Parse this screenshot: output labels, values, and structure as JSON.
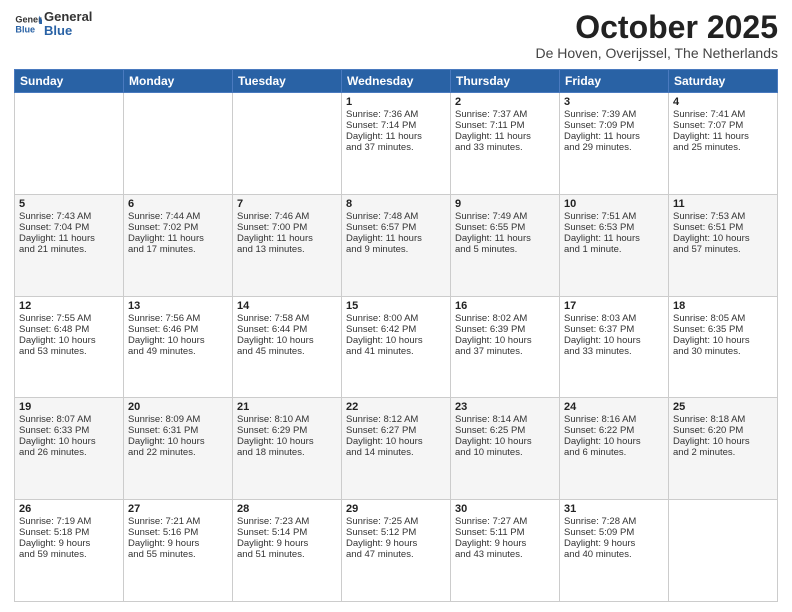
{
  "logo": {
    "general": "General",
    "blue": "Blue"
  },
  "title": "October 2025",
  "location": "De Hoven, Overijssel, The Netherlands",
  "days_of_week": [
    "Sunday",
    "Monday",
    "Tuesday",
    "Wednesday",
    "Thursday",
    "Friday",
    "Saturday"
  ],
  "weeks": [
    [
      {
        "day": "",
        "lines": []
      },
      {
        "day": "",
        "lines": []
      },
      {
        "day": "",
        "lines": []
      },
      {
        "day": "1",
        "lines": [
          "Sunrise: 7:36 AM",
          "Sunset: 7:14 PM",
          "Daylight: 11 hours",
          "and 37 minutes."
        ]
      },
      {
        "day": "2",
        "lines": [
          "Sunrise: 7:37 AM",
          "Sunset: 7:11 PM",
          "Daylight: 11 hours",
          "and 33 minutes."
        ]
      },
      {
        "day": "3",
        "lines": [
          "Sunrise: 7:39 AM",
          "Sunset: 7:09 PM",
          "Daylight: 11 hours",
          "and 29 minutes."
        ]
      },
      {
        "day": "4",
        "lines": [
          "Sunrise: 7:41 AM",
          "Sunset: 7:07 PM",
          "Daylight: 11 hours",
          "and 25 minutes."
        ]
      }
    ],
    [
      {
        "day": "5",
        "lines": [
          "Sunrise: 7:43 AM",
          "Sunset: 7:04 PM",
          "Daylight: 11 hours",
          "and 21 minutes."
        ]
      },
      {
        "day": "6",
        "lines": [
          "Sunrise: 7:44 AM",
          "Sunset: 7:02 PM",
          "Daylight: 11 hours",
          "and 17 minutes."
        ]
      },
      {
        "day": "7",
        "lines": [
          "Sunrise: 7:46 AM",
          "Sunset: 7:00 PM",
          "Daylight: 11 hours",
          "and 13 minutes."
        ]
      },
      {
        "day": "8",
        "lines": [
          "Sunrise: 7:48 AM",
          "Sunset: 6:57 PM",
          "Daylight: 11 hours",
          "and 9 minutes."
        ]
      },
      {
        "day": "9",
        "lines": [
          "Sunrise: 7:49 AM",
          "Sunset: 6:55 PM",
          "Daylight: 11 hours",
          "and 5 minutes."
        ]
      },
      {
        "day": "10",
        "lines": [
          "Sunrise: 7:51 AM",
          "Sunset: 6:53 PM",
          "Daylight: 11 hours",
          "and 1 minute."
        ]
      },
      {
        "day": "11",
        "lines": [
          "Sunrise: 7:53 AM",
          "Sunset: 6:51 PM",
          "Daylight: 10 hours",
          "and 57 minutes."
        ]
      }
    ],
    [
      {
        "day": "12",
        "lines": [
          "Sunrise: 7:55 AM",
          "Sunset: 6:48 PM",
          "Daylight: 10 hours",
          "and 53 minutes."
        ]
      },
      {
        "day": "13",
        "lines": [
          "Sunrise: 7:56 AM",
          "Sunset: 6:46 PM",
          "Daylight: 10 hours",
          "and 49 minutes."
        ]
      },
      {
        "day": "14",
        "lines": [
          "Sunrise: 7:58 AM",
          "Sunset: 6:44 PM",
          "Daylight: 10 hours",
          "and 45 minutes."
        ]
      },
      {
        "day": "15",
        "lines": [
          "Sunrise: 8:00 AM",
          "Sunset: 6:42 PM",
          "Daylight: 10 hours",
          "and 41 minutes."
        ]
      },
      {
        "day": "16",
        "lines": [
          "Sunrise: 8:02 AM",
          "Sunset: 6:39 PM",
          "Daylight: 10 hours",
          "and 37 minutes."
        ]
      },
      {
        "day": "17",
        "lines": [
          "Sunrise: 8:03 AM",
          "Sunset: 6:37 PM",
          "Daylight: 10 hours",
          "and 33 minutes."
        ]
      },
      {
        "day": "18",
        "lines": [
          "Sunrise: 8:05 AM",
          "Sunset: 6:35 PM",
          "Daylight: 10 hours",
          "and 30 minutes."
        ]
      }
    ],
    [
      {
        "day": "19",
        "lines": [
          "Sunrise: 8:07 AM",
          "Sunset: 6:33 PM",
          "Daylight: 10 hours",
          "and 26 minutes."
        ]
      },
      {
        "day": "20",
        "lines": [
          "Sunrise: 8:09 AM",
          "Sunset: 6:31 PM",
          "Daylight: 10 hours",
          "and 22 minutes."
        ]
      },
      {
        "day": "21",
        "lines": [
          "Sunrise: 8:10 AM",
          "Sunset: 6:29 PM",
          "Daylight: 10 hours",
          "and 18 minutes."
        ]
      },
      {
        "day": "22",
        "lines": [
          "Sunrise: 8:12 AM",
          "Sunset: 6:27 PM",
          "Daylight: 10 hours",
          "and 14 minutes."
        ]
      },
      {
        "day": "23",
        "lines": [
          "Sunrise: 8:14 AM",
          "Sunset: 6:25 PM",
          "Daylight: 10 hours",
          "and 10 minutes."
        ]
      },
      {
        "day": "24",
        "lines": [
          "Sunrise: 8:16 AM",
          "Sunset: 6:22 PM",
          "Daylight: 10 hours",
          "and 6 minutes."
        ]
      },
      {
        "day": "25",
        "lines": [
          "Sunrise: 8:18 AM",
          "Sunset: 6:20 PM",
          "Daylight: 10 hours",
          "and 2 minutes."
        ]
      }
    ],
    [
      {
        "day": "26",
        "lines": [
          "Sunrise: 7:19 AM",
          "Sunset: 5:18 PM",
          "Daylight: 9 hours",
          "and 59 minutes."
        ]
      },
      {
        "day": "27",
        "lines": [
          "Sunrise: 7:21 AM",
          "Sunset: 5:16 PM",
          "Daylight: 9 hours",
          "and 55 minutes."
        ]
      },
      {
        "day": "28",
        "lines": [
          "Sunrise: 7:23 AM",
          "Sunset: 5:14 PM",
          "Daylight: 9 hours",
          "and 51 minutes."
        ]
      },
      {
        "day": "29",
        "lines": [
          "Sunrise: 7:25 AM",
          "Sunset: 5:12 PM",
          "Daylight: 9 hours",
          "and 47 minutes."
        ]
      },
      {
        "day": "30",
        "lines": [
          "Sunrise: 7:27 AM",
          "Sunset: 5:11 PM",
          "Daylight: 9 hours",
          "and 43 minutes."
        ]
      },
      {
        "day": "31",
        "lines": [
          "Sunrise: 7:28 AM",
          "Sunset: 5:09 PM",
          "Daylight: 9 hours",
          "and 40 minutes."
        ]
      },
      {
        "day": "",
        "lines": []
      }
    ]
  ]
}
